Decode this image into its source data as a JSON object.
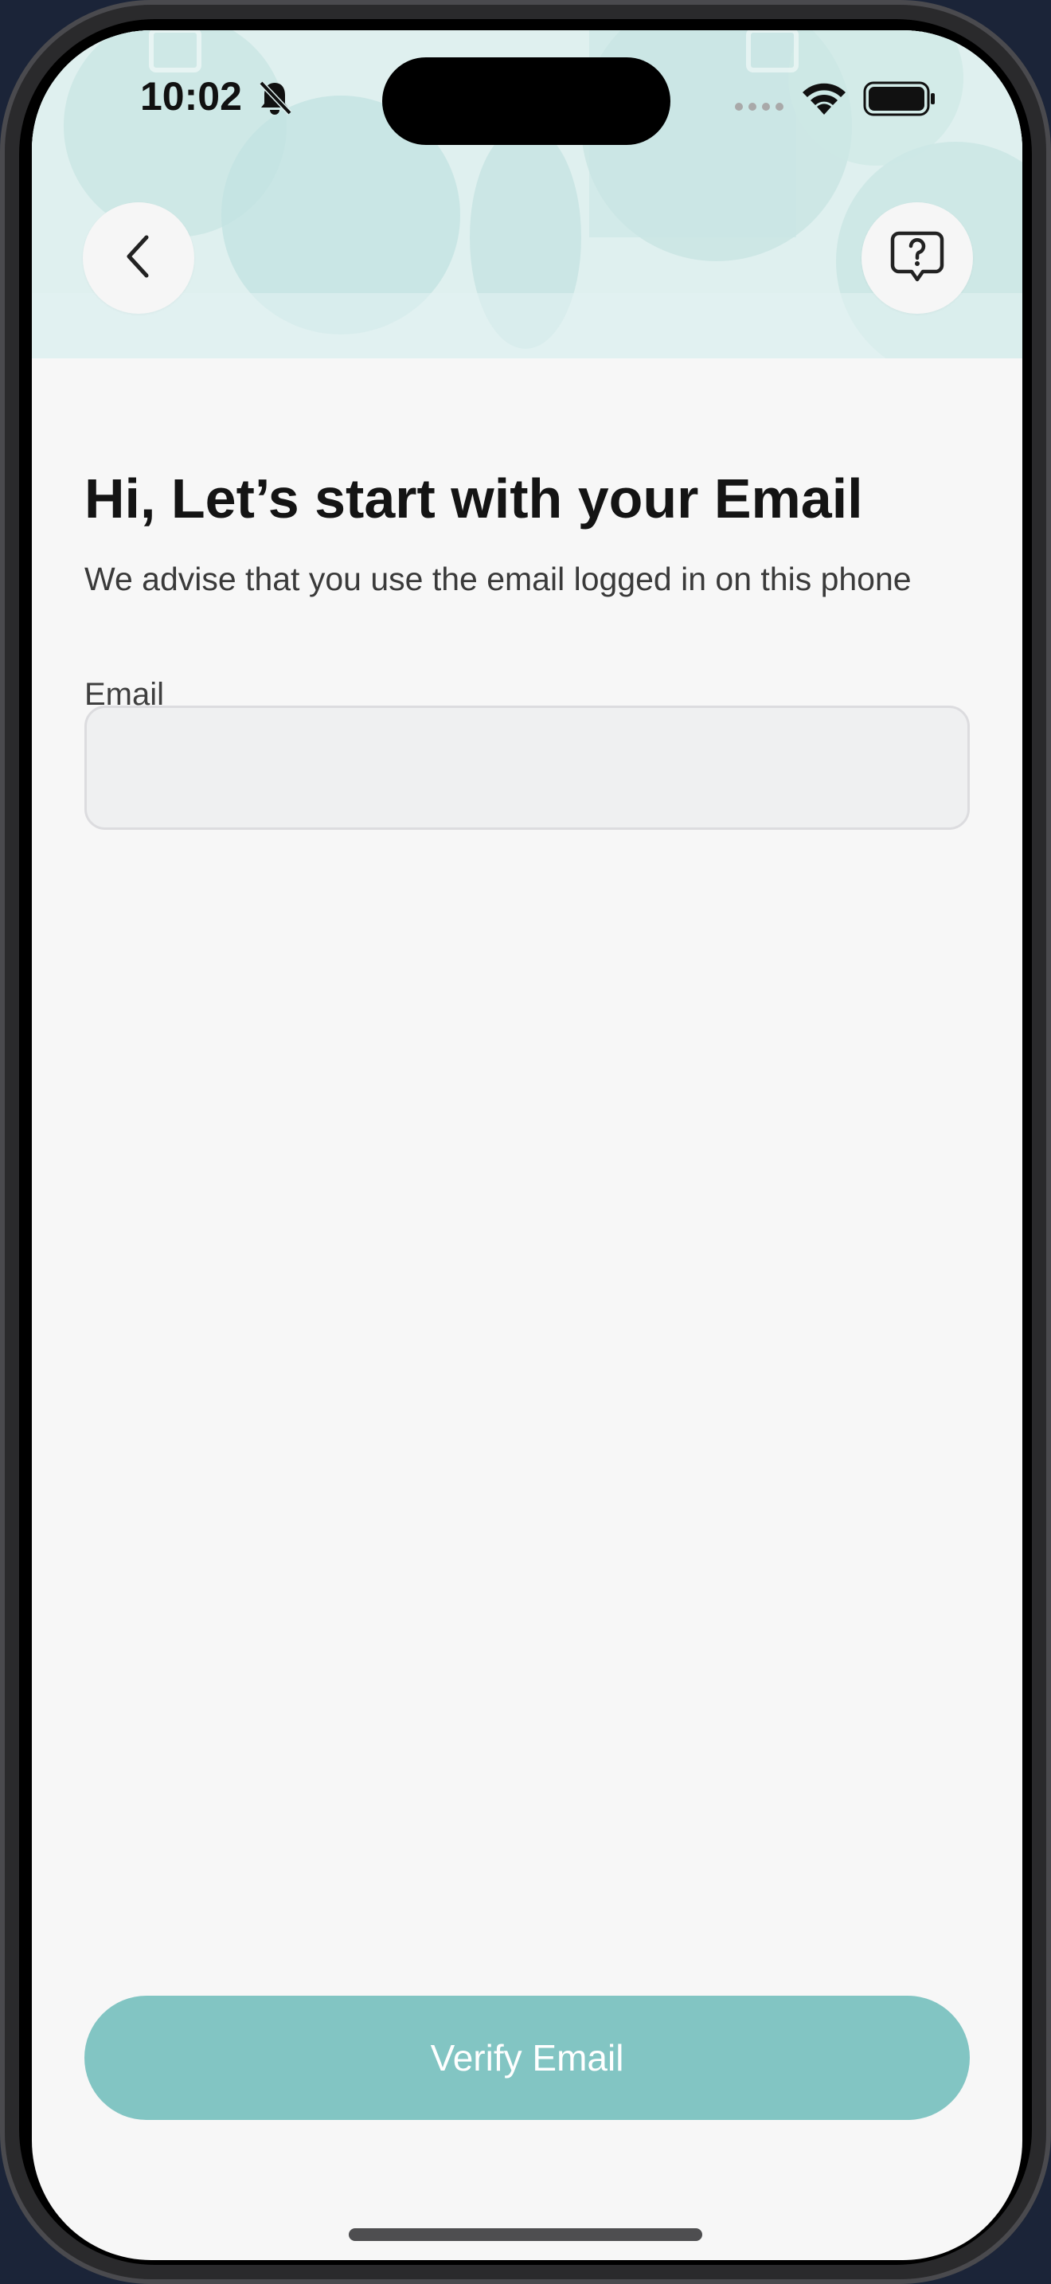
{
  "status_bar": {
    "time": "10:02",
    "icons": [
      "bell-slash-icon",
      "signal-icon",
      "wifi-icon",
      "battery-icon"
    ]
  },
  "header": {
    "back_icon": "chevron-left-icon",
    "help_icon": "question-bubble-icon"
  },
  "main": {
    "title": "Hi, Let’s start with your Email",
    "subtitle": "We advise that you use the email logged in on this phone",
    "email_label": "Email",
    "email_value": "",
    "email_placeholder": ""
  },
  "footer": {
    "verify_label": "Verify Email"
  },
  "colors": {
    "accent": "#82c5c3",
    "header_bg": "#dff0ef",
    "screen_bg": "#f7f7f7",
    "input_bg": "#eff0f1"
  }
}
